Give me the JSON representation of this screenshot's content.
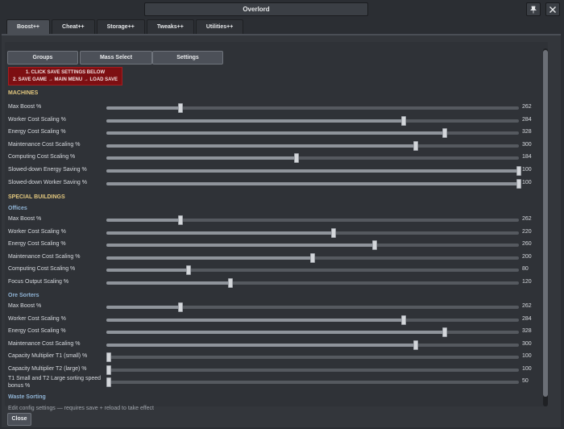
{
  "window": {
    "title": "Overlord"
  },
  "tabs": [
    "Boost++",
    "Cheat++",
    "Storage++",
    "Tweaks++",
    "Utilities++"
  ],
  "active_tab": "Boost++",
  "toolbar": {
    "groups": "Groups",
    "mass_select": "Mass Select",
    "settings": "Settings"
  },
  "warning": {
    "line1": "1. CLICK SAVE SETTINGS BELOW",
    "line2": "2. SAVE GAME → MAIN MENU → LOAD SAVE"
  },
  "sections": {
    "machines": {
      "title": "MACHINES",
      "rows": [
        {
          "label": "Max Boost %",
          "value": "262",
          "fraction": 0.18
        },
        {
          "label": "Worker Cost Scaling %",
          "value": "284",
          "fraction": 0.72
        },
        {
          "label": "Energy Cost Scaling %",
          "value": "328",
          "fraction": 0.82
        },
        {
          "label": "Maintenance Cost Scaling %",
          "value": "300",
          "fraction": 0.75
        },
        {
          "label": "Computing Cost Scaling %",
          "value": "184",
          "fraction": 0.46
        },
        {
          "label": "Slowed-down Energy Saving %",
          "value": "100",
          "fraction": 1.0
        },
        {
          "label": "Slowed-down Worker Saving %",
          "value": "100",
          "fraction": 1.0
        }
      ]
    },
    "special_buildings": {
      "title": "SPECIAL BUILDINGS",
      "offices": {
        "title": "Offices",
        "rows": [
          {
            "label": "Max Boost %",
            "value": "262",
            "fraction": 0.18
          },
          {
            "label": "Worker Cost Scaling %",
            "value": "220",
            "fraction": 0.55
          },
          {
            "label": "Energy Cost Scaling %",
            "value": "260",
            "fraction": 0.65
          },
          {
            "label": "Maintenance Cost Scaling %",
            "value": "200",
            "fraction": 0.5
          },
          {
            "label": "Computing Cost Scaling %",
            "value": "80",
            "fraction": 0.2
          },
          {
            "label": "Focus Output Scaling %",
            "value": "120",
            "fraction": 0.3
          }
        ]
      },
      "ore_sorters": {
        "title": "Ore Sorters",
        "rows": [
          {
            "label": "Max Boost %",
            "value": "262",
            "fraction": 0.18
          },
          {
            "label": "Worker Cost Scaling %",
            "value": "284",
            "fraction": 0.72
          },
          {
            "label": "Energy Cost Scaling %",
            "value": "328",
            "fraction": 0.82
          },
          {
            "label": "Maintenance Cost Scaling %",
            "value": "300",
            "fraction": 0.75
          },
          {
            "label": "Capacity Multiplier T1 (small) %",
            "value": "100",
            "fraction": 0.0
          },
          {
            "label": "Capacity Multiplier T2 (large) %",
            "value": "100",
            "fraction": 0.0
          },
          {
            "label": "T1 Small and T2 Large sorting speed bonus %",
            "value": "50",
            "fraction": 0.0
          }
        ]
      },
      "waste_sorting": {
        "title": "Waste Sorting"
      }
    }
  },
  "footer": {
    "note": "Edit config settings — requires save + reload to take effect",
    "close": "Close"
  }
}
